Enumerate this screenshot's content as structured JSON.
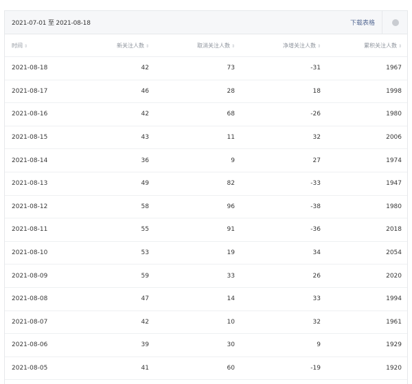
{
  "toolbar": {
    "date_range": "2021-07-01 至 2021-08-18",
    "download_label": "下载表格"
  },
  "icons": {
    "sort": "sort-icon",
    "help": "help-icon"
  },
  "colors": {
    "link": "#576b95",
    "header_bg": "#f6f7f9",
    "border": "#e6e8eb"
  },
  "table": {
    "columns": [
      "时间",
      "新关注人数",
      "取消关注人数",
      "净增关注人数",
      "累积关注人数"
    ],
    "rows": [
      [
        "2021-08-18",
        "42",
        "73",
        "-31",
        "1967"
      ],
      [
        "2021-08-17",
        "46",
        "28",
        "18",
        "1998"
      ],
      [
        "2021-08-16",
        "42",
        "68",
        "-26",
        "1980"
      ],
      [
        "2021-08-15",
        "43",
        "11",
        "32",
        "2006"
      ],
      [
        "2021-08-14",
        "36",
        "9",
        "27",
        "1974"
      ],
      [
        "2021-08-13",
        "49",
        "82",
        "-33",
        "1947"
      ],
      [
        "2021-08-12",
        "58",
        "96",
        "-38",
        "1980"
      ],
      [
        "2021-08-11",
        "55",
        "91",
        "-36",
        "2018"
      ],
      [
        "2021-08-10",
        "53",
        "19",
        "34",
        "2054"
      ],
      [
        "2021-08-09",
        "59",
        "33",
        "26",
        "2020"
      ],
      [
        "2021-08-08",
        "47",
        "14",
        "33",
        "1994"
      ],
      [
        "2021-08-07",
        "42",
        "10",
        "32",
        "1961"
      ],
      [
        "2021-08-06",
        "39",
        "30",
        "9",
        "1929"
      ],
      [
        "2021-08-05",
        "41",
        "60",
        "-19",
        "1920"
      ]
    ]
  }
}
